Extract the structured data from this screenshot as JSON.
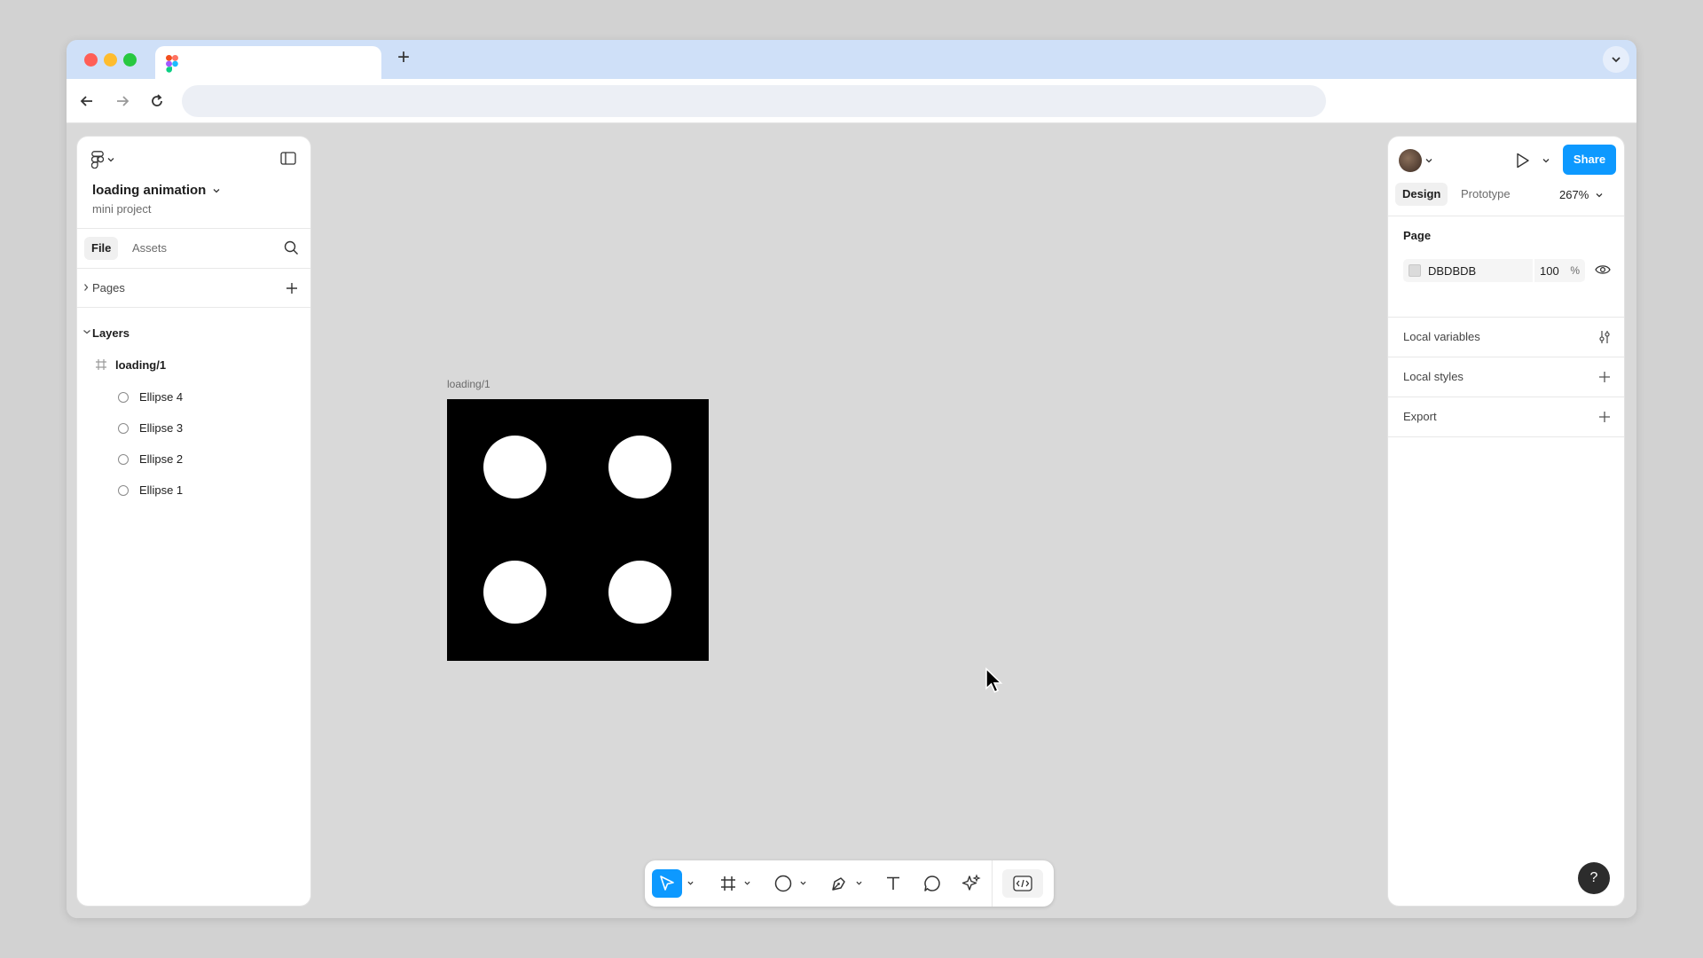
{
  "colors": {
    "accent": "#0d99ff",
    "canvas_bg": "#d9d9d9",
    "frame_fill": "#000000",
    "ellipse_fill": "#ffffff",
    "page_bg_swatch": "#dbdbdb"
  },
  "file": {
    "title": "loading animation",
    "project": "mini project"
  },
  "left_panel": {
    "tabs": [
      {
        "label": "File",
        "active": true
      },
      {
        "label": "Assets",
        "active": false
      }
    ],
    "pages_label": "Pages",
    "layers_label": "Layers",
    "layers": {
      "frame": "loading/1",
      "children": [
        "Ellipse 4",
        "Ellipse 3",
        "Ellipse 2",
        "Ellipse 1"
      ]
    }
  },
  "canvas": {
    "frame_label": "loading/1"
  },
  "right_panel": {
    "share_label": "Share",
    "tabs": [
      {
        "label": "Design",
        "active": true
      },
      {
        "label": "Prototype",
        "active": false
      }
    ],
    "zoom": "267%",
    "page_section": {
      "title": "Page",
      "bg_hex": "DBDBDB",
      "opacity": "100",
      "opacity_unit": "%"
    },
    "local_variables": "Local variables",
    "local_styles": "Local styles",
    "export": "Export",
    "help": "?"
  },
  "toolbar_icons": [
    "move-icon",
    "frame-icon",
    "ellipse-icon",
    "pen-icon",
    "text-icon",
    "comment-icon",
    "actions-icon",
    "dev-mode-icon"
  ]
}
